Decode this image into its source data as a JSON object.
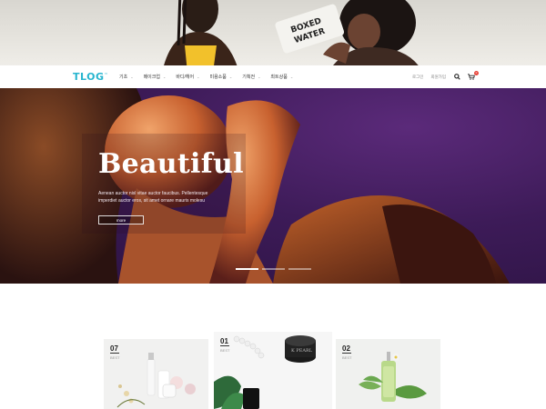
{
  "header": {
    "logo": "TLOG",
    "logo_mark": "™",
    "nav": [
      {
        "label": "기초"
      },
      {
        "label": "메이크업"
      },
      {
        "label": "바디/헤어"
      },
      {
        "label": "미용소품"
      },
      {
        "label": "기획전"
      },
      {
        "label": "최트상품"
      }
    ],
    "login_label": "로그인",
    "join_label": "회원가입",
    "cart_count": "0"
  },
  "hero": {
    "title": "Beautiful",
    "description": "Aenean auctor nisl vitae auctor faucibus. Pellentesque imperdiet auctor eros, sit amet ornare mauris molesu",
    "button_label": "more",
    "slide_count": 3,
    "active_slide": 1
  },
  "products": [
    {
      "number": "07",
      "label": "BEST"
    },
    {
      "number": "01",
      "label": "BEST"
    },
    {
      "number": "02",
      "label": "BEST"
    }
  ],
  "colors": {
    "brand": "#27b5cf",
    "hero_bg": "#3d1b58",
    "badge": "#e8443a"
  }
}
